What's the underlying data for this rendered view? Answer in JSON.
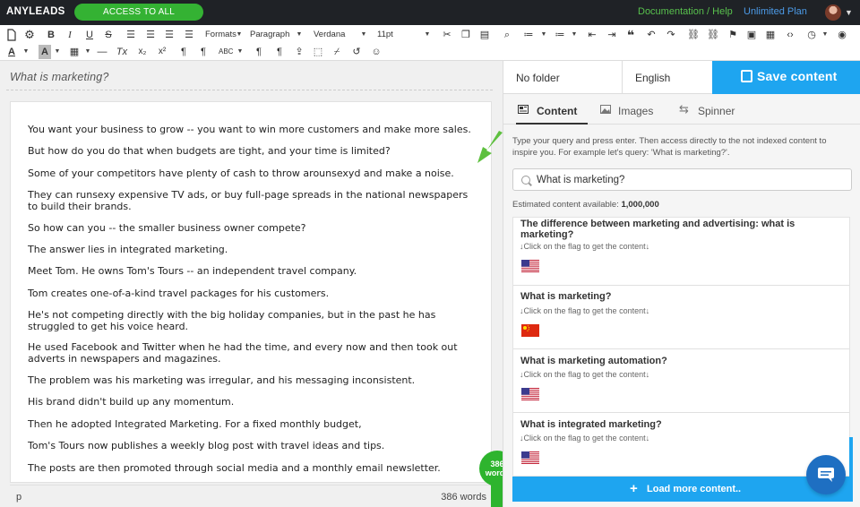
{
  "topbar": {
    "logo": "ANYLEADS",
    "access_button": "ACCESS TO ALL PRODUCTS..",
    "documentation": "Documentation / Help",
    "plan": "Unlimited Plan"
  },
  "toolbar": {
    "formats": "Formats",
    "block": "Paragraph",
    "font": "Verdana",
    "size": "11pt"
  },
  "editor": {
    "title": "What is marketing?",
    "paragraphs": [
      "You want your business to grow -- you want to win more customers and make more sales.",
      "But how do you do that when budgets are tight, and your time is limited?",
      "Some of your competitors have plenty of cash to throw arounsexyd and make a noise.",
      "They can runsexy expensive TV ads, or buy full-page spreads in the national newspapers to build their brands.",
      "So how can you -- the smaller business owner compete?",
      "The answer lies in integrated marketing.",
      "Meet Tom. He owns Tom's Tours -- an independent travel company.",
      "Tom creates one-of-a-kind travel packages for his customers.",
      "He's not competing directly with the big holiday companies, but in the past he has struggled to get his voice heard.",
      "He used Facebook and Twitter when he had the time, and every now and then took out adverts in newspapers and magazines.",
      "The problem was his marketing was irregular, and his messaging inconsistent.",
      "His brand didn't build up any momentum.",
      "Then he adopted Integrated Marketing. For a fixed monthly budget,",
      "Tom's Tours now publishes a weekly blog post with travel ideas and tips.",
      "The posts are then promoted through social media and a monthly email newsletter."
    ],
    "status_element": "p",
    "status_words": "386 words",
    "badge_count": "386",
    "badge_unit": "words"
  },
  "sidebar": {
    "folder": "No folder",
    "language": "English",
    "save_label": "Save content",
    "tabs": [
      {
        "label": "Content"
      },
      {
        "label": "Images"
      },
      {
        "label": "Spinner"
      }
    ],
    "hint": "Type your query and press enter. Then access directly to the not indexed content to inspire you. For example let's query: 'What is marketing?'.",
    "search_value": "What is marketing?",
    "estimated_label": "Estimated content available:",
    "estimated_value": "1,000,000",
    "results": [
      {
        "title": "The difference between marketing and advertising: what is marketing?",
        "hint": "↓Click on the flag to get the content↓",
        "flag": "us-flag-icon"
      },
      {
        "title": "What is marketing?",
        "hint": "↓Click on the flag to get the content↓",
        "flag": "china-flag-icon"
      },
      {
        "title": "What is marketing automation?",
        "hint": "↓Click on the flag to get the content↓",
        "flag": "us-flag-icon"
      },
      {
        "title": "What is integrated marketing?",
        "hint": "↓Click on the flag to get the content↓",
        "flag": "us-flag-icon"
      }
    ],
    "load_more": "Load more content..",
    "load_more_icon": "+"
  },
  "colors": {
    "topbar": "#1f2226",
    "green": "#34b233",
    "blue": "#1ea5f0",
    "chat": "#1e6fc2"
  }
}
